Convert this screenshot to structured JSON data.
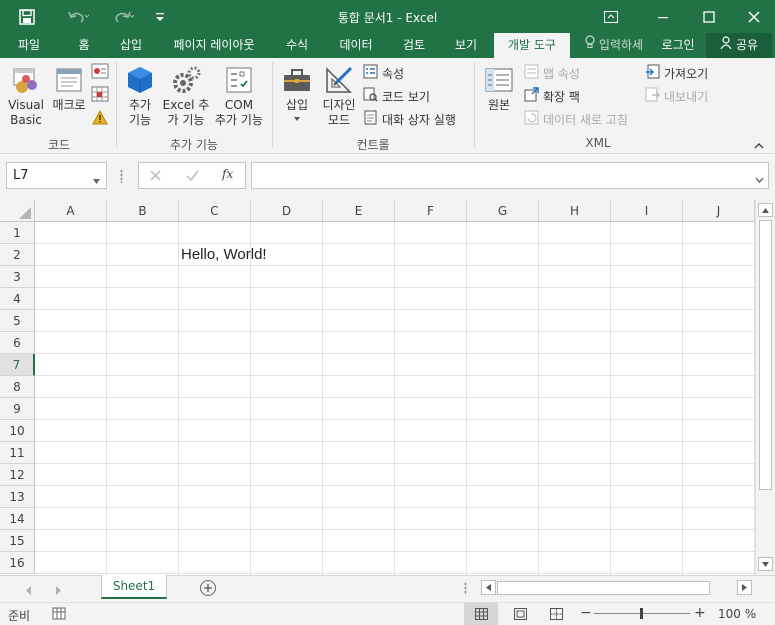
{
  "window": {
    "title": "통합 문서1 - Excel"
  },
  "tabs": [
    "파일",
    "홈",
    "삽입",
    "페이지 레이아웃",
    "수식",
    "데이터",
    "검토",
    "보기",
    "개발 도구"
  ],
  "tell_me": "입력하세",
  "sign_in": "로그인",
  "share": "공유",
  "ribbon": {
    "code": {
      "visual_basic": [
        "Visual",
        "Basic"
      ],
      "macro": "매크로",
      "group": "코드"
    },
    "addins": {
      "addins": [
        "추가",
        "기능"
      ],
      "excel_addins": [
        "Excel 추",
        "가 기능"
      ],
      "com_addins": [
        "COM",
        "추가 기능"
      ],
      "group": "추가 기능"
    },
    "controls": {
      "insert": "삽입",
      "design_mode": [
        "디자인",
        "모드"
      ],
      "properties": "속성",
      "view_code": "코드 보기",
      "run_dialog": "대화 상자 실행",
      "group": "컨트롤"
    },
    "xml": {
      "source": "원본",
      "map_properties": "맵 속성",
      "expansion_packs": "확장 팩",
      "refresh_data": "데이터 새로 고침",
      "import": "가져오기",
      "export": "내보내기",
      "group": "XML"
    }
  },
  "formula_bar": {
    "name_box": "L7",
    "fx": "fx",
    "content": ""
  },
  "columns": [
    "A",
    "B",
    "C",
    "D",
    "E",
    "F",
    "G",
    "H",
    "I",
    "J"
  ],
  "rows": [
    "1",
    "2",
    "3",
    "4",
    "5",
    "6",
    "7",
    "8",
    "9",
    "10",
    "11",
    "12",
    "13",
    "14",
    "15",
    "16"
  ],
  "cells": {
    "C2": "Hello, World!"
  },
  "selected_row": "7",
  "sheets": [
    "Sheet1"
  ],
  "status": {
    "ready": "준비",
    "zoom": "100 %"
  },
  "colors": {
    "accent": "#217346",
    "ribbon_bg": "#f3f3f3"
  }
}
